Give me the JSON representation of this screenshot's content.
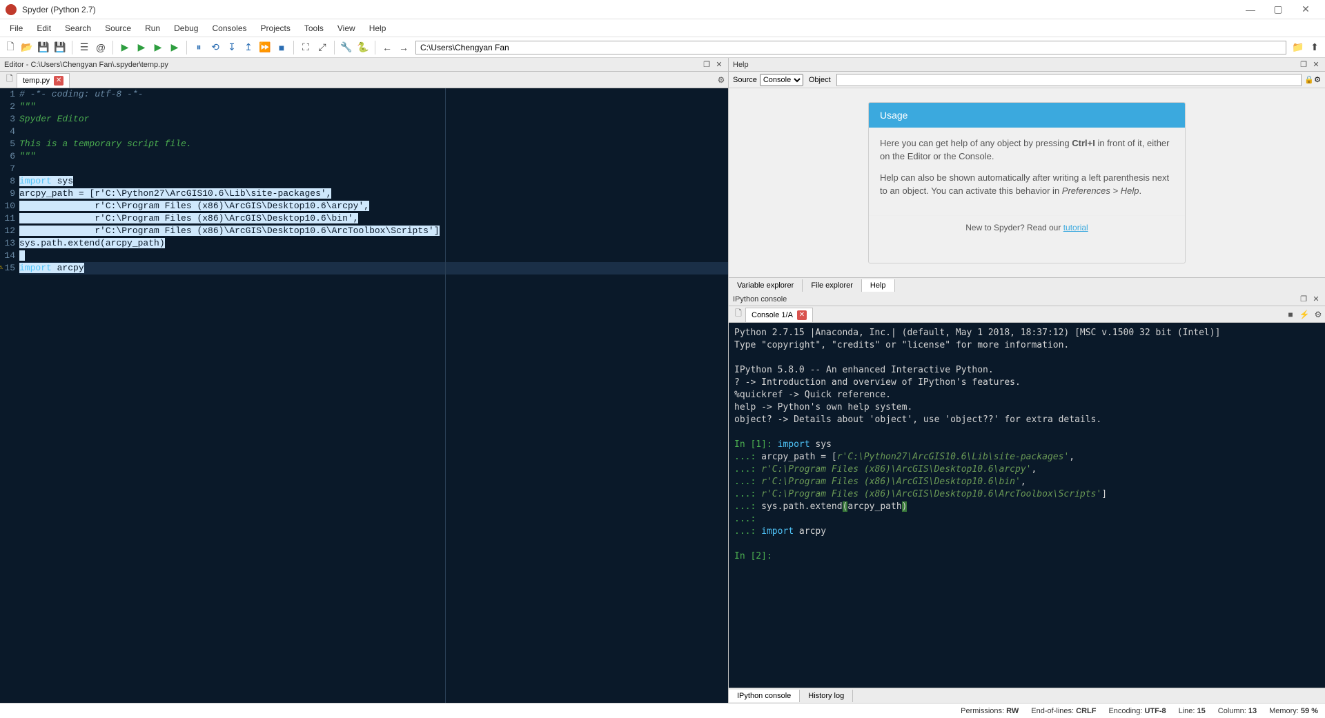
{
  "window": {
    "title": "Spyder (Python 2.7)"
  },
  "menu": [
    "File",
    "Edit",
    "Search",
    "Source",
    "Run",
    "Debug",
    "Consoles",
    "Projects",
    "Tools",
    "View",
    "Help"
  ],
  "toolbar": {
    "path": "C:\\Users\\Chengyan Fan"
  },
  "editor": {
    "pane_title": "Editor - C:\\Users\\Chengyan Fan\\.spyder\\temp.py",
    "tab": "temp.py",
    "lines": [
      {
        "n": 1,
        "html": "<span class='cmt'># -*- coding: utf-8 -*-</span>"
      },
      {
        "n": 2,
        "html": "<span class='str'>\"\"\"</span>"
      },
      {
        "n": 3,
        "html": "<span class='str'>Spyder Editor</span>"
      },
      {
        "n": 4,
        "html": ""
      },
      {
        "n": 5,
        "html": "<span class='str'>This is a temporary script file.</span>"
      },
      {
        "n": 6,
        "html": "<span class='str'>\"\"\"</span>"
      },
      {
        "n": 7,
        "html": ""
      },
      {
        "n": 8,
        "html": "<span class='sel'><span class='kw'>import</span> sys</span>"
      },
      {
        "n": 9,
        "html": "<span class='sel'>arcpy_path = [r'C:\\Python27\\ArcGIS10.6\\Lib\\site-packages',</span>"
      },
      {
        "n": 10,
        "html": "<span class='sel'>              r'C:\\Program Files (x86)\\ArcGIS\\Desktop10.6\\arcpy',</span>"
      },
      {
        "n": 11,
        "html": "<span class='sel'>              r'C:\\Program Files (x86)\\ArcGIS\\Desktop10.6\\bin',</span>"
      },
      {
        "n": 12,
        "html": "<span class='sel'>              r'C:\\Program Files (x86)\\ArcGIS\\Desktop10.6\\ArcToolbox\\Scripts']</span>"
      },
      {
        "n": 13,
        "html": "<span class='sel'>sys.path.extend(arcpy_path)</span>"
      },
      {
        "n": 14,
        "html": "<span class='sel'> </span>"
      },
      {
        "n": 15,
        "warn": true,
        "cursor": true,
        "html": "<span class='sel'><span class='kw'>import</span> arcpy</span>"
      }
    ]
  },
  "help": {
    "pane_title": "Help",
    "source_label": "Source",
    "source_value": "Console",
    "object_label": "Object",
    "usage_title": "Usage",
    "usage_p1_pre": "Here you can get help of any object by pressing ",
    "usage_p1_key": "Ctrl+I",
    "usage_p1_post": " in front of it, either on the Editor or the Console.",
    "usage_p2_pre": "Help can also be shown automatically after writing a left parenthesis next to an object. You can activate this behavior in ",
    "usage_p2_em": "Preferences > Help",
    "usage_p2_post": ".",
    "footer_pre": "New to Spyder? Read our ",
    "footer_link": "tutorial",
    "tabs": [
      "Variable explorer",
      "File explorer",
      "Help"
    ]
  },
  "console": {
    "pane_title": "IPython console",
    "tab": "Console 1/A",
    "bottom_tabs": [
      "IPython console",
      "History log"
    ],
    "text": {
      "l1": "Python 2.7.15 |Anaconda, Inc.| (default, May  1 2018, 18:37:12) [MSC v.1500 32 bit (Intel)]",
      "l2": "Type \"copyright\", \"credits\" or \"license\" for more information.",
      "l3": "IPython 5.8.0 -- An enhanced Interactive Python.",
      "l4": "?         -> Introduction and overview of IPython's features.",
      "l5": "%quickref -> Quick reference.",
      "l6": "help      -> Python's own help system.",
      "l7": "object?   -> Details about 'object', use 'object??' for extra details.",
      "in1": "In [1]: ",
      "in2": "In [2]: ",
      "cont": "   ...: ",
      "c1a": "import",
      "c1b": " sys",
      "c2": "arcpy_path = [",
      "p1": "r'C:\\Python27\\ArcGIS10.6\\Lib\\site-packages'",
      "p2": "r'C:\\Program Files (x86)\\ArcGIS\\Desktop10.6\\arcpy'",
      "p3": "r'C:\\Program Files (x86)\\ArcGIS\\Desktop10.6\\bin'",
      "p4": "r'C:\\Program Files (x86)\\ArcGIS\\Desktop10.6\\ArcToolbox\\Scripts'",
      "c3a": "sys.path.extend",
      "c3b": "(",
      "c3c": "arcpy_path",
      "c3d": ")",
      "c4a": "import",
      "c4b": " arcpy"
    }
  },
  "status": {
    "perm_lbl": "Permissions:",
    "perm_val": "RW",
    "eol_lbl": "End-of-lines:",
    "eol_val": "CRLF",
    "enc_lbl": "Encoding:",
    "enc_val": "UTF-8",
    "line_lbl": "Line:",
    "line_val": "15",
    "col_lbl": "Column:",
    "col_val": "13",
    "mem_lbl": "Memory:",
    "mem_val": "59 %"
  }
}
